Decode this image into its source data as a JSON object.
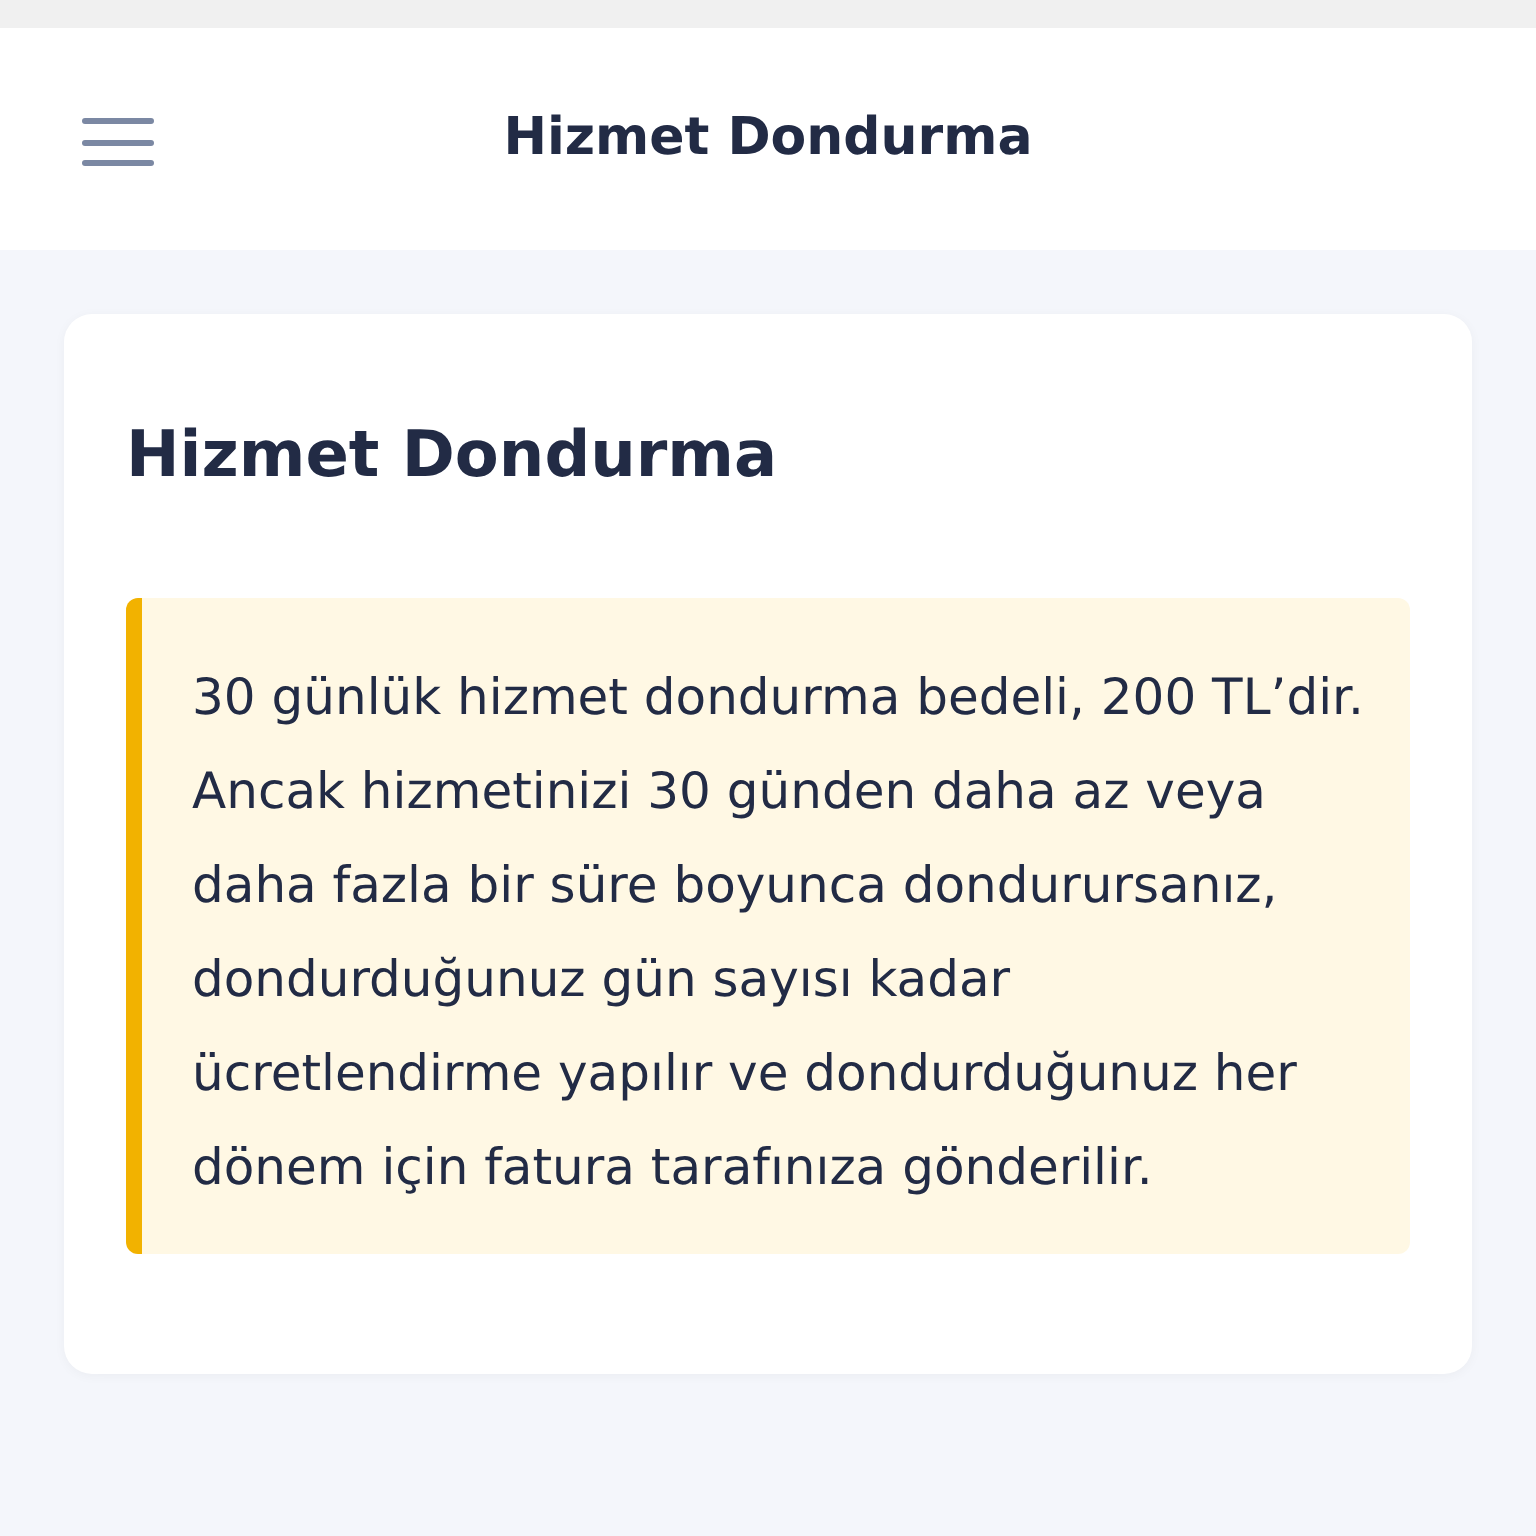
{
  "header": {
    "title": "Hizmet Dondurma"
  },
  "card": {
    "title": "Hizmet Dondurma",
    "notice": "30 günlük hizmet dondurma bedeli, 200 TL’dir. Ancak hizmetinizi 30 günden daha az veya daha fazla bir süre boyunca dondurursanız, dondurduğunuz gün sayısı kadar ücretlendirme yapılır ve dondurduğunuz her dönem için fatura tarafınıza gönderilir."
  }
}
